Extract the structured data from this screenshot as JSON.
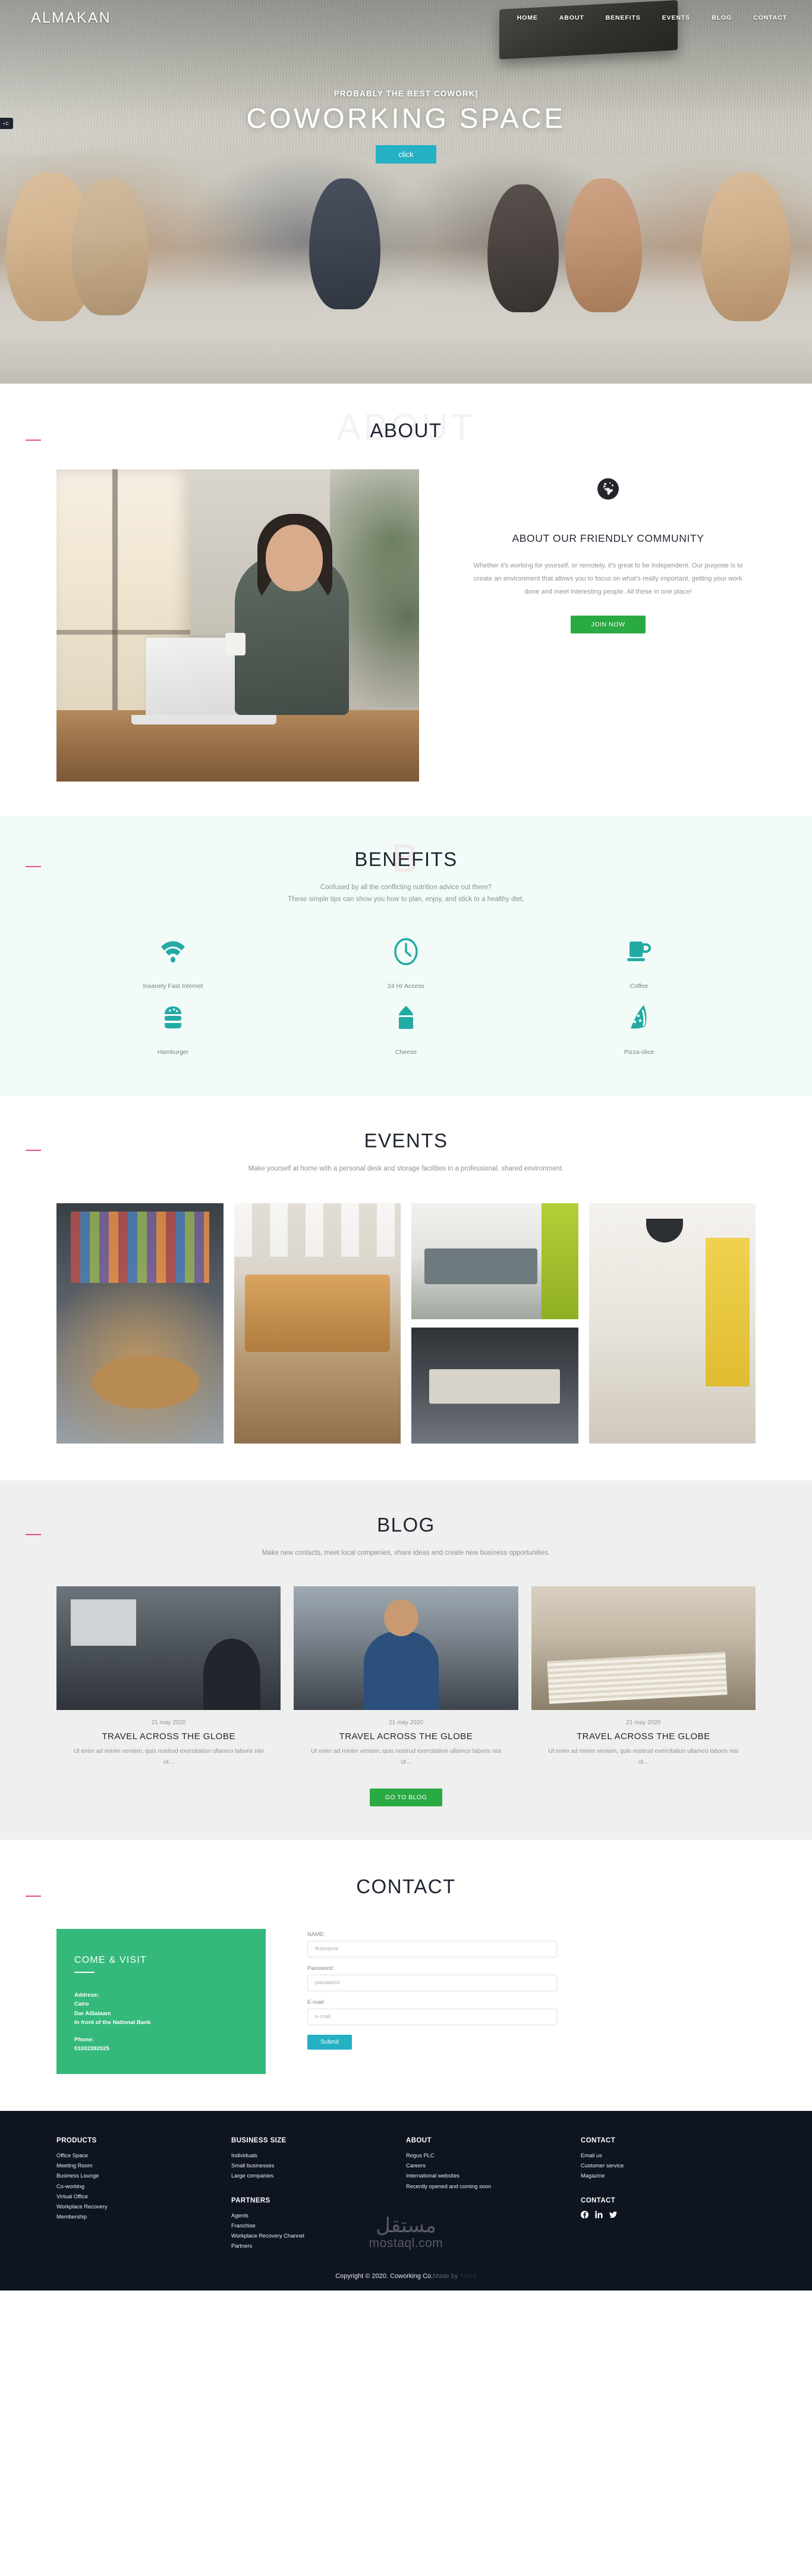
{
  "brand": "ALMAKAN",
  "nav": {
    "items": [
      {
        "label": "HOME"
      },
      {
        "label": "ABOUT"
      },
      {
        "label": "BENEFITS"
      },
      {
        "label": "EVENTS"
      },
      {
        "label": "BLOG"
      },
      {
        "label": "CONTACT"
      }
    ]
  },
  "side_tag": "«C",
  "hero": {
    "kicker": "PROBABLY THE BEST COWORK|",
    "title": "COWORKING SPACE",
    "button": "click",
    "button_color": "#25b0c4"
  },
  "about": {
    "section_title": "ABOUT",
    "ghost_title": "ABOUT",
    "icon": "globe-icon",
    "heading": "ABOUT OUR FRIENDLY COMMUNITY",
    "paragraph": "Whether it's working for yourself, or remotely, it's great to be independent. Our purpose is to create an environment that allows you to focus on what's really important, getting your work done and meet interesting people. All these in one place!",
    "button": "JOIN NOW",
    "button_color": "#2aaa43"
  },
  "benefits": {
    "section_title": "BENEFITS",
    "ghost_title": "B",
    "sub_line1": "Confused by all the conflicting nutrition advice out there?",
    "sub_line2": "These simple tips can show you how to plan, enjoy, and stick to a healthy diet.",
    "accent": "#23aaa4",
    "items": [
      {
        "icon": "wifi-icon",
        "label": "Insanely Fast Internet"
      },
      {
        "icon": "clock-icon",
        "label": "24 Hr Access"
      },
      {
        "icon": "coffee-cup-icon",
        "label": "Coffee"
      },
      {
        "icon": "hamburger-icon",
        "label": "Hamburger"
      },
      {
        "icon": "cheese-icon",
        "label": "Cheese"
      },
      {
        "icon": "pizza-slice-icon",
        "label": "Pizza-slice"
      }
    ]
  },
  "events": {
    "section_title": "EVENTS",
    "subtitle": "Make yourself at home with a personal desk and storage facilities in a professional, shared environment."
  },
  "blog": {
    "section_title": "BLOG",
    "subtitle": "Make new contacts, meet local companies, share ideas and create new business opportunities.",
    "button": "GO TO BLOG",
    "button_color": "#2aaa43",
    "posts": [
      {
        "date": "21 may 2020",
        "title": "TRAVEL ACROSS THE GLOBE",
        "excerpt": "Ut enim ad minim veniam, quis nostrud exercitation ullamco laboris nisi ut..."
      },
      {
        "date": "21 may 2020",
        "title": "TRAVEL ACROSS THE GLOBE",
        "excerpt": "Ut enim ad minim veniam, quis nostrud exercitation ullamco laboris nisi ut..."
      },
      {
        "date": "21 may 2020",
        "title": "TRAVEL ACROSS THE GLOBE",
        "excerpt": "Ut enim ad minim veniam, quis nostrud exercitation ullamco laboris nisi ut..."
      }
    ]
  },
  "contact": {
    "section_title": "CONTACT",
    "visit": {
      "title": "COME & VISIT",
      "address_label": "Address:",
      "address_line1": "Cairo",
      "address_line2": "Dar AlSalaam",
      "address_line3": "In front of the National Bank",
      "phone_label": "Phone:",
      "phone_value": "01002392025",
      "bg_color": "#34b97a"
    },
    "form": {
      "name_label": "NAME:",
      "name_placeholder": "firstname",
      "password_label": "Password:",
      "password_placeholder": "password",
      "email_label": "E-mail:",
      "email_placeholder": "e-mail",
      "submit": "Submit",
      "submit_color": "#25b0c4"
    }
  },
  "footer": {
    "columns": [
      {
        "heading": "PRODUCTS",
        "links": [
          "Office Space",
          "Meeting Room",
          "Business Lounge",
          "Co-working",
          "Virtual Office",
          "Workplace Recovery",
          "Membership"
        ]
      },
      {
        "heading": "BUSINESS SIZE",
        "links": [
          "Individuals",
          "Small businesses",
          "Large companies"
        ],
        "heading2": "PARTNERS",
        "links2": [
          "Agents",
          "Franchise",
          "Workplace Recovery Channel",
          "Partners"
        ]
      },
      {
        "heading": "ABOUT",
        "links": [
          "Regus PLC",
          "Careers",
          "International websites",
          "Recently opened and coming soon"
        ]
      },
      {
        "heading": "CONTACT",
        "links": [
          "Email us",
          "Customer service",
          "Magazine"
        ],
        "heading2": "CONTACT",
        "socials": [
          "facebook-icon",
          "linkedin-icon",
          "twitter-icon"
        ]
      }
    ],
    "watermark_ar": "مستقل",
    "watermark_en": "mostaql.com",
    "copyright": "Copyright © 2020. Coworking Co.",
    "made_by": "Made by ",
    "made_by_name": "TAHA"
  }
}
